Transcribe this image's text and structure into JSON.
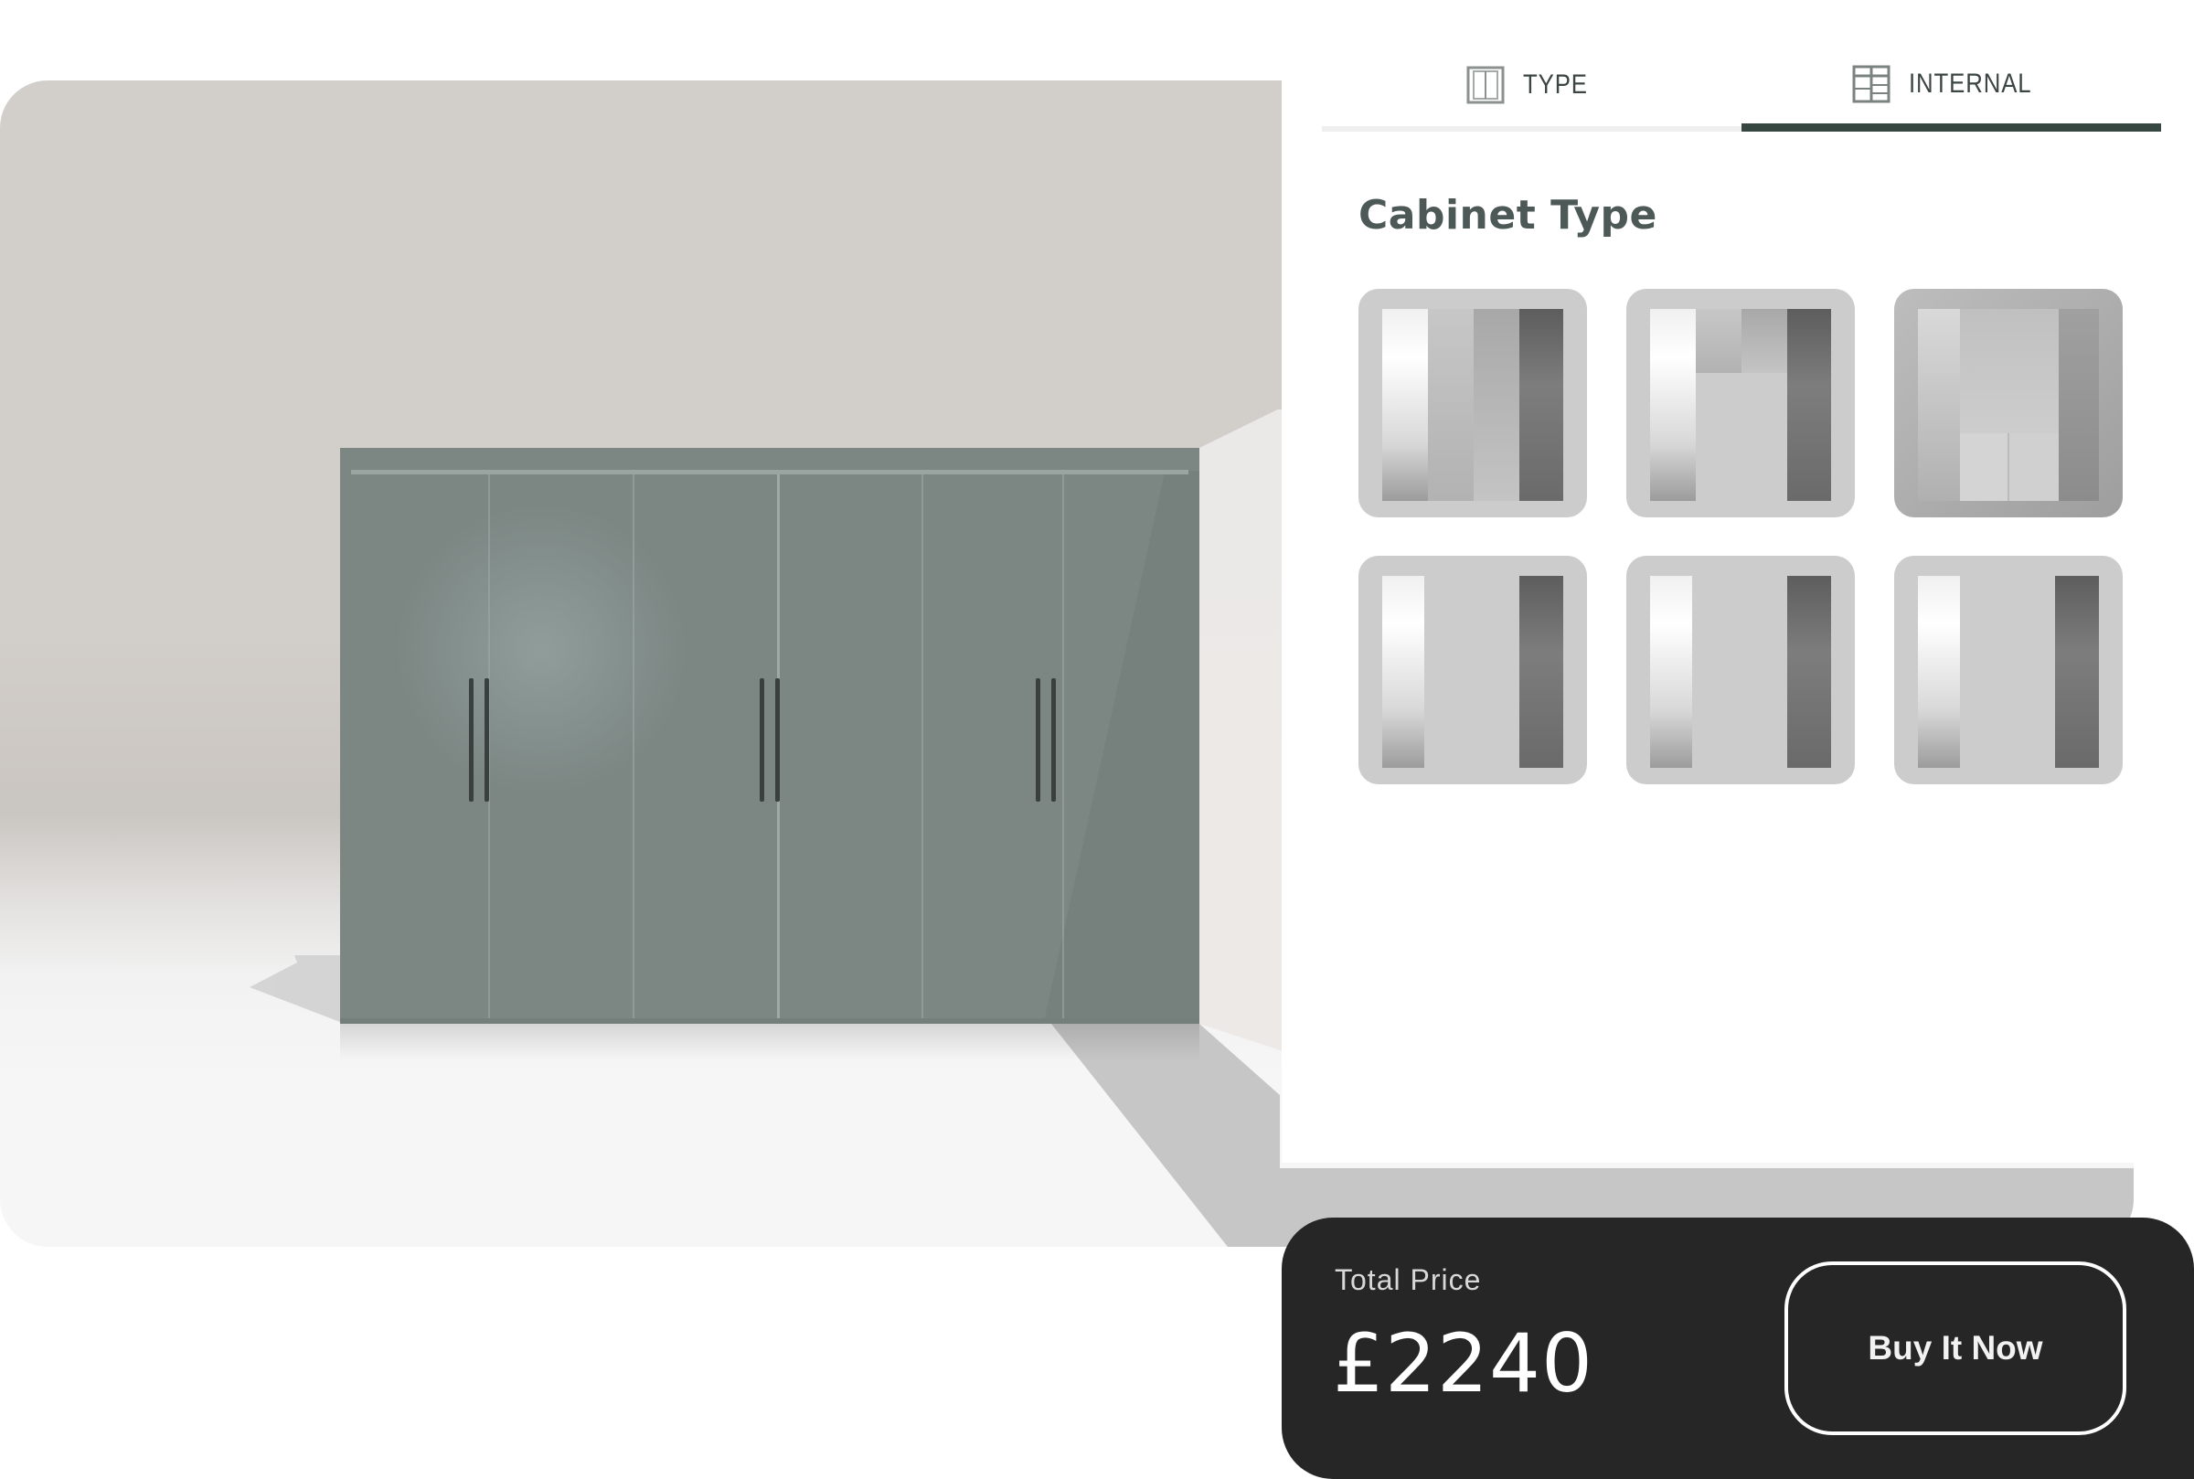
{
  "tabs": [
    {
      "label": "TYPE",
      "icon": "cabinet-type-icon",
      "active": false
    },
    {
      "label": "INTERNAL",
      "icon": "internal-layout-icon",
      "active": true
    }
  ],
  "section": {
    "title": "Cabinet Type"
  },
  "cabinet_options": [
    {
      "name": "four-panel-layout",
      "selected": false
    },
    {
      "name": "shelves-top-hanging-layout",
      "selected": false
    },
    {
      "name": "drawers-bottom-layout",
      "selected": true
    },
    {
      "name": "open-layout-1",
      "selected": false
    },
    {
      "name": "open-layout-2",
      "selected": false
    },
    {
      "name": "open-layout-3",
      "selected": false
    }
  ],
  "price": {
    "label": "Total Price",
    "value": "£2240"
  },
  "actions": {
    "buy_label": "Buy It Now"
  },
  "colors": {
    "accent": "#364640",
    "wardrobe": "#7c8784",
    "wall": "#d2ceca",
    "price_bar": "#262626"
  }
}
